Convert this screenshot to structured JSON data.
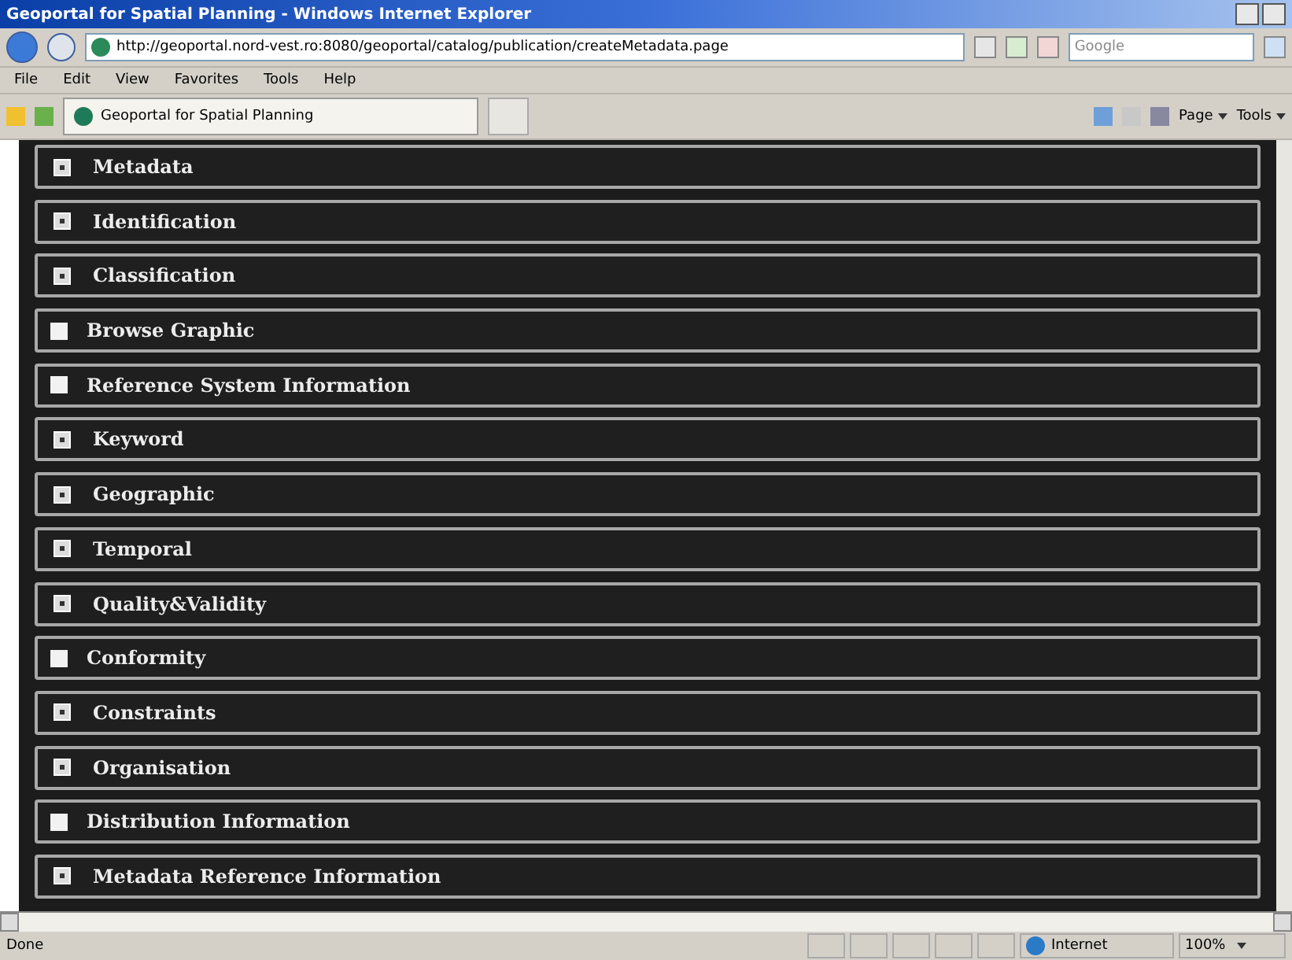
{
  "window": {
    "title": "Geoportal for Spatial Planning - Windows Internet Explorer"
  },
  "address_bar": {
    "url": "http://geoportal.nord-vest.ro:8080/geoportal/catalog/publication/createMetadata.page"
  },
  "search": {
    "placeholder": "Google"
  },
  "menu": [
    "File",
    "Edit",
    "View",
    "Favorites",
    "Tools",
    "Help"
  ],
  "tab": {
    "label": "Geoportal for Spatial Planning"
  },
  "command_bar": [
    "Page",
    "Tools"
  ],
  "sections": [
    {
      "label": "Metadata",
      "kind": "expander"
    },
    {
      "label": "Identification",
      "kind": "expander"
    },
    {
      "label": "Classification",
      "kind": "expander"
    },
    {
      "label": "Browse Graphic",
      "kind": "checkbox",
      "checked": false
    },
    {
      "label": "Reference System Information",
      "kind": "checkbox",
      "checked": false
    },
    {
      "label": "Keyword",
      "kind": "expander"
    },
    {
      "label": "Geographic",
      "kind": "expander"
    },
    {
      "label": "Temporal",
      "kind": "expander"
    },
    {
      "label": "Quality&Validity",
      "kind": "expander"
    },
    {
      "label": "Conformity",
      "kind": "checkbox",
      "checked": false
    },
    {
      "label": "Constraints",
      "kind": "expander"
    },
    {
      "label": "Organisation",
      "kind": "expander"
    },
    {
      "label": "Distribution Information",
      "kind": "checkbox",
      "checked": false
    },
    {
      "label": "Metadata Reference Information",
      "kind": "expander"
    }
  ],
  "status_bar": {
    "status": "Done",
    "zone": "Internet",
    "zoom": "100%"
  }
}
